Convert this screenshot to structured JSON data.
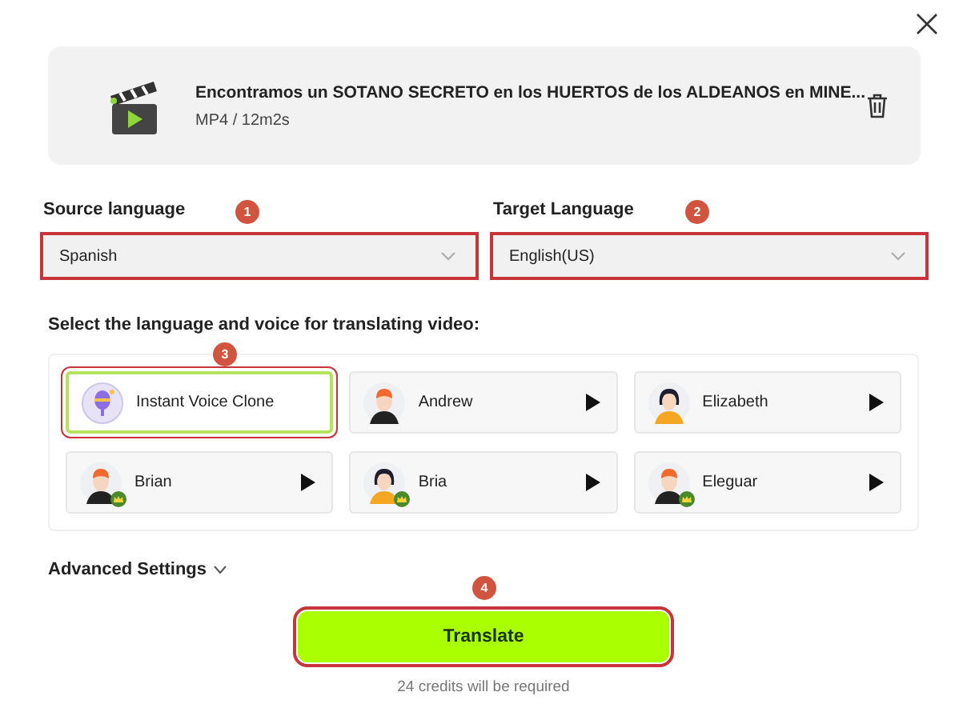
{
  "file": {
    "title": "Encontramos un SOTANO SECRETO en los HUERTOS de los ALDEANOS en MINE...",
    "meta": "MP4 / 12m2s"
  },
  "languages": [
    {
      "label": "Source language",
      "value": "Spanish",
      "callout": "1"
    },
    {
      "label": "Target Language",
      "value": "English(US)",
      "callout": "2"
    }
  ],
  "voices_heading": "Select the language and voice for translating video:",
  "voices": [
    {
      "name": "Instant Voice Clone",
      "kind": "clone",
      "selected": true,
      "premium": false,
      "callout": "3"
    },
    {
      "name": "Andrew",
      "kind": "male",
      "selected": false,
      "premium": false
    },
    {
      "name": "Elizabeth",
      "kind": "female",
      "selected": false,
      "premium": false
    },
    {
      "name": "Brian",
      "kind": "male",
      "selected": false,
      "premium": true
    },
    {
      "name": "Bria",
      "kind": "female",
      "selected": false,
      "premium": true
    },
    {
      "name": "Eleguar",
      "kind": "male",
      "selected": false,
      "premium": true
    }
  ],
  "advanced": {
    "label": "Advanced Settings",
    "expanded": false
  },
  "translate": {
    "label": "Translate",
    "callout": "4"
  },
  "credits": "24 credits will be required"
}
